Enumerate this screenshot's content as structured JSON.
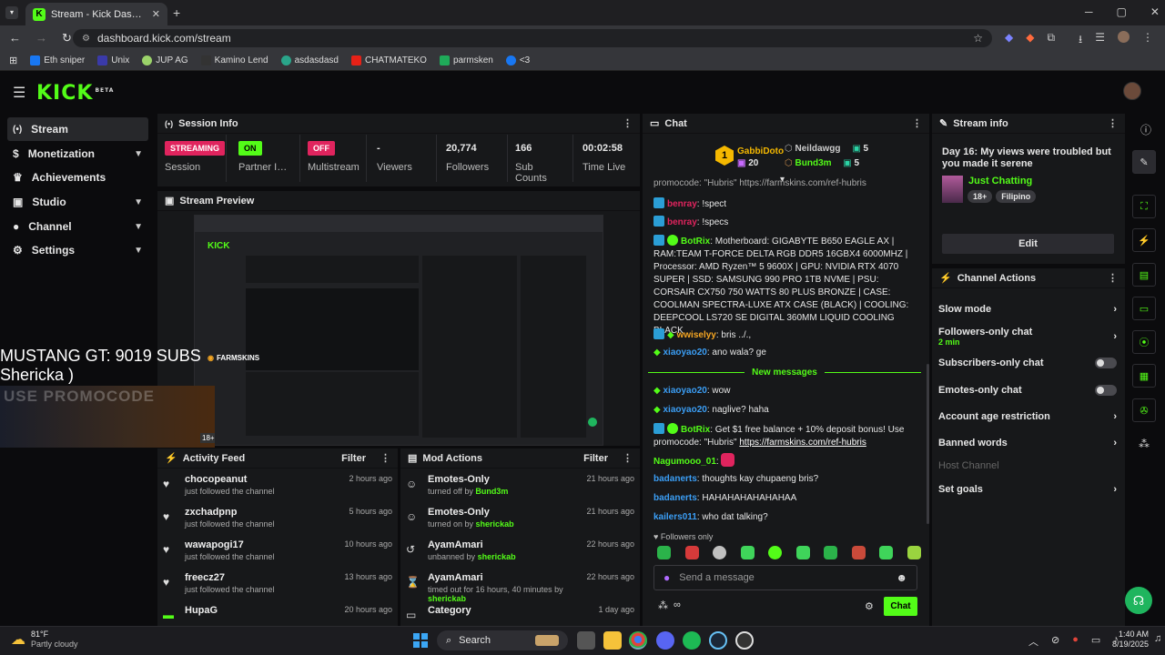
{
  "browser": {
    "tab_title": "Stream - Kick Dashboard",
    "url": "dashboard.kick.com/stream",
    "bookmarks": [
      "Eth sniper",
      "Unix",
      "JUP AG",
      "Kamino Lend",
      "asdasdasd",
      "CHATMATEKO",
      "parmsken",
      "<3"
    ]
  },
  "brand": {
    "logo": "KICK",
    "beta": "BETA",
    "accent": "#53fc18"
  },
  "nav": [
    "Stream",
    "Monetization",
    "Achievements",
    "Studio",
    "Channel",
    "Settings"
  ],
  "session": {
    "title": "Session Info",
    "streaming": "STREAMING",
    "session_label": "Session",
    "partner_val": "ON",
    "partner_label": "Partner Income",
    "multi_val": "OFF",
    "multi_label": "Multistream",
    "viewers_val": "-",
    "viewers_label": "Viewers",
    "followers_val": "20,774",
    "followers_label": "Followers",
    "subs_val": "166",
    "subs_label": "Sub Counts",
    "time_val": "00:02:58",
    "time_label": "Time Live"
  },
  "preview": {
    "title": "Stream Preview",
    "overlay1": "MUSTANG GT: 9019 SUBS",
    "overlay2": "Shericka )",
    "promo": "USE PROMOCODE",
    "farmskins": "FARMSKINS",
    "badge18": "18+"
  },
  "activity": {
    "title": "Activity Feed",
    "filter": "Filter",
    "items": [
      {
        "name": "chocopeanut",
        "sub": "just followed the channel",
        "time": "2 hours ago"
      },
      {
        "name": "zxchadpnp",
        "sub": "just followed the channel",
        "time": "5 hours ago"
      },
      {
        "name": "wawapogi17",
        "sub": "just followed the channel",
        "time": "10 hours ago"
      },
      {
        "name": "freecz27",
        "sub": "just followed the channel",
        "time": "13 hours ago"
      },
      {
        "name": "HupaG",
        "sub": "",
        "time": "20 hours ago"
      }
    ]
  },
  "mod": {
    "title": "Mod Actions",
    "filter": "Filter",
    "items": [
      {
        "name": "Emotes-Only",
        "pre": "turned off by ",
        "by": "Bund3m",
        "time": "21 hours ago",
        "icon": "☺"
      },
      {
        "name": "Emotes-Only",
        "pre": "turned on by ",
        "by": "sherickab",
        "time": "21 hours ago",
        "icon": "☺"
      },
      {
        "name": "AyamAmari",
        "pre": "unbanned by ",
        "by": "sherickab",
        "time": "22 hours ago",
        "icon": "↺"
      },
      {
        "name": "AyamAmari",
        "pre": "timed out for 16 hours, 40 minutes by ",
        "by": "sherickab",
        "time": "22 hours ago",
        "icon": "⌛"
      },
      {
        "name": "Category",
        "pre": "",
        "by": "",
        "time": "1 day ago",
        "icon": "▭"
      }
    ]
  },
  "chat": {
    "title": "Chat",
    "top1_rank": "1",
    "top1_name": "GabbiDoto",
    "top1_count": "20",
    "top2_name": "Neildawgg",
    "top2_count": "5",
    "top3_name": "Bund3m",
    "top3_count": "5",
    "cut_text": "promocode: \"Hubris\" https://farmskins.com/ref-hubris",
    "m1_user": "benray",
    "m1_text": ": !spect",
    "m2_user": "benray",
    "m2_text": ": !specs",
    "m3_user": "BotRix",
    "m3_text": ": Motherboard: GIGABYTE B650 EAGLE AX | RAM:TEAM T-FORCE DELTA RGB DDR5 16GBX4 6000MHZ | Processor: AMD Ryzen™ 5 9600X | GPU: NVIDIA RTX 4070 SUPER | SSD: SAMSUNG 990 PRO 1TB NVME | PSU: CORSAIR CX750 750 WATTS 80 PLUS BRONZE | CASE: COOLMAN SPECTRA-LUXE ATX CASE (BLACK) | COOLING: DEEPCOOL LS720 SE DIGITAL 360MM LIQUID COOLING BLACK",
    "m4_user": "wwiselyy",
    "m4_text": ": bris ../.,",
    "m5_user": "xiaoyao20",
    "m5_text": ": ano wala? ge",
    "new_messages": "New messages",
    "m6_user": "xiaoyao20",
    "m6_text": ": wow",
    "m7_user": "xiaoyao20",
    "m7_text": ": naglive? haha",
    "m8_user": "BotRix",
    "m8_text": ": Get $1 free balance + 10% deposit bonus! Use promocode: \"Hubris\" ",
    "m8_link": "https://farmskins.com/ref-hubris",
    "m9_user": "Nagumooo_01",
    "m9_text": ":",
    "m10_user": "badanerts",
    "m10_text": ": thoughts kay chupaeng bris?",
    "m11_user": "badanerts",
    "m11_text": ": HAHAHAHAHAHAHAA",
    "m12_user": "kailers011",
    "m12_text": ": who dat talking?",
    "followers_only": "Followers only",
    "placeholder": "Send a message",
    "send": "Chat"
  },
  "info": {
    "title": "Stream info",
    "stream_title": "Day 16: My views were troubled but you made it serene",
    "category": "Just Chatting",
    "tag1": "18+",
    "tag2": "Filipino",
    "edit": "Edit"
  },
  "actions": {
    "title": "Channel Actions",
    "slow": "Slow mode",
    "followers": "Followers-only chat",
    "followers_sub": "2 min",
    "subsonly": "Subscribers-only chat",
    "emotes": "Emotes-only chat",
    "age": "Account age restriction",
    "banned": "Banned words",
    "host": "Host Channel",
    "goals": "Set goals"
  },
  "taskbar": {
    "temp": "81°F",
    "weather": "Partly cloudy",
    "search": "Search",
    "time": "1:40 AM",
    "date": "8/19/2025"
  }
}
